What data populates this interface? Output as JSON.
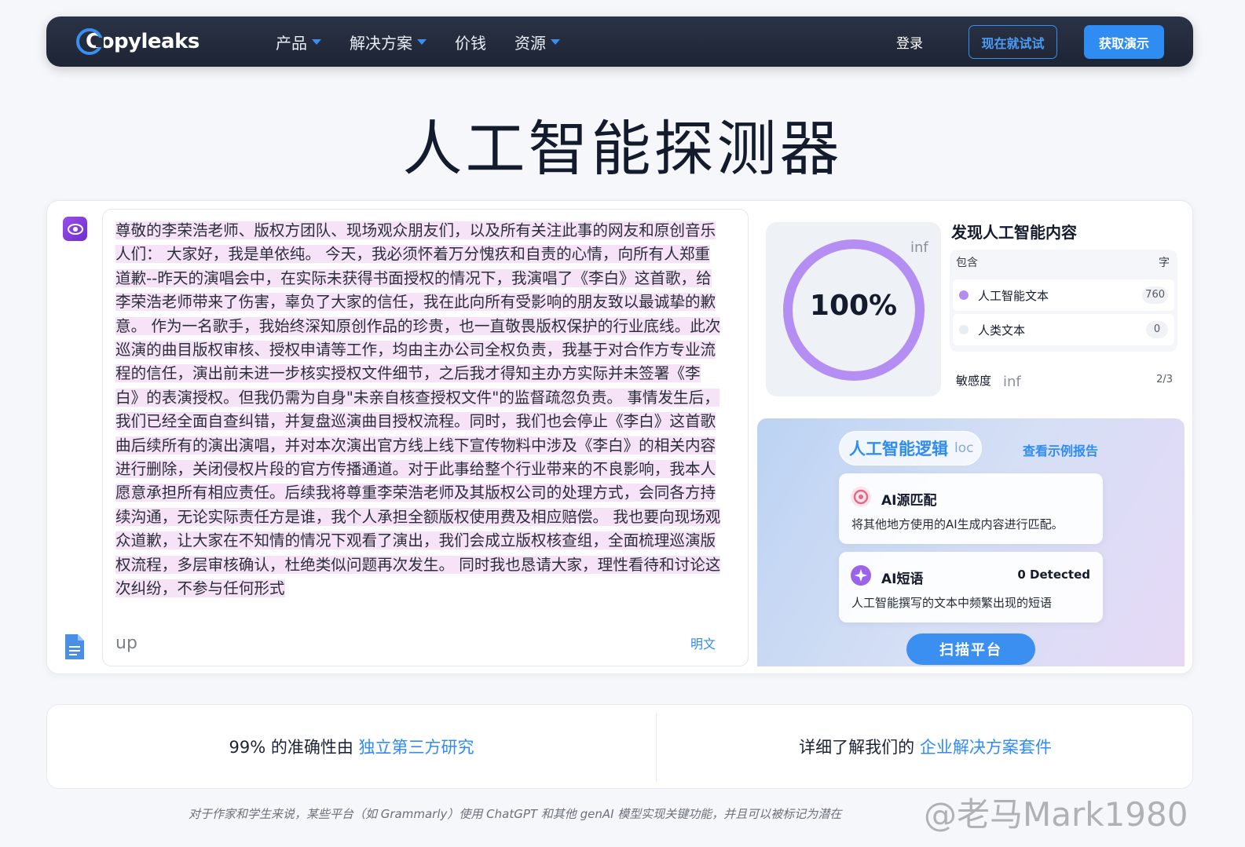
{
  "navbar": {
    "logo_text": "Copyleaks",
    "menu": [
      {
        "label": "产品",
        "has_caret": true
      },
      {
        "label": "解决方案",
        "has_caret": true
      },
      {
        "label": "价钱",
        "has_caret": false
      },
      {
        "label": "资源",
        "has_caret": true
      }
    ],
    "login_label": "登录",
    "try_label": "现在就试试",
    "demo_label": "获取演示",
    "accent_color": "#2f8cf2"
  },
  "page_title": "人工智能探测器",
  "editor": {
    "text": "尊敬的李荣浩老师、版权方团队、现场观众朋友们，以及所有关注此事的网友和原创音乐人们： 大家好，我是单依纯。 今天，我必须怀着万分愧疚和自责的心情，向所有人郑重道歉--昨天的演唱会中，在实际未获得书面授权的情况下，我演唱了《李白》这首歌，给李荣浩老师带来了伤害，辜负了大家的信任，我在此向所有受影响的朋友致以最诚挚的歉意。 作为一名歌手，我始终深知原创作品的珍贵，也一直敬畏版权保护的行业底线。此次巡演的曲目版权审核、授权申请等工作，均由主办公司全权负责，我基于对合作方专业流程的信任，演出前未进一步核实授权文件细节，之后我才得知主办方实际并未签署《李白》的表演授权。但我仍需为自身\"未亲自核查授权文件\"的监督疏忽负责。 事情发生后，我们已经全面自查纠错，并复盘巡演曲目授权流程。同时，我们也会停止《李白》这首歌曲后续所有的演出演唱，并对本次演出官方线上线下宣传物料中涉及《李白》的相关内容进行删除，关闭侵权片段的官方传播通道。对于此事给整个行业带来的不良影响，我本人愿意承担所有相应责任。后续我将尊重李荣浩老师及其版权公司的处理方式，会同各方持续沟通，无论实际责任方是谁，我个人承担全额版权使用费及相应赔偿。 我也要向现场观众道歉，让大家在不知情的情况下观看了演出，我们会成立版权核查组，全面梳理巡演版权流程，多层审核确认，杜绝类似问题再次发生。 同时我也恳请大家，理性看待和讨论这次纠纷，不参与任何形式",
    "input_value": "up",
    "plaintext_label": "明文",
    "highlight_color": "#f6e3f8"
  },
  "result": {
    "score": "100%",
    "score_suffix": "inf",
    "ai_fraction": 1.0,
    "title": "发现人工智能内容",
    "table_header_left": "包含",
    "table_header_right": "字",
    "rows": [
      {
        "label": "人工智能文本",
        "count": "760",
        "dot_color": "#b68cf0"
      },
      {
        "label": "人类文本",
        "count": "0",
        "dot_color": "#e8ecf3"
      }
    ],
    "sensitivity_label": "敏感度",
    "sensitivity_inf": "inf",
    "sensitivity_value": "2/3"
  },
  "logic": {
    "pill_title": "人工智能逻辑",
    "pill_suffix": "loc",
    "view_report": "查看示例报告",
    "cards": [
      {
        "title": "AI源匹配",
        "desc": "将其他地方使用的AI生成内容进行匹配。",
        "detected": ""
      },
      {
        "title": "AI短语",
        "desc": "人工智能撰写的文本中频繁出现的短语",
        "detected": "0 Detected"
      }
    ],
    "scan_label": "扫描平台"
  },
  "info": {
    "left_prefix": "99% 的准确性由 ",
    "left_link": "独立第三方研究",
    "right_prefix": "详细了解我们的 ",
    "right_link": "企业解决方案套件"
  },
  "footnote": "对于作家和学生来说，某些平台（如 Grammarly）使用 ChatGPT 和其他 genAI 模型实现关键功能，并且可以被标记为潜在",
  "watermark": "@老马Mark1980"
}
